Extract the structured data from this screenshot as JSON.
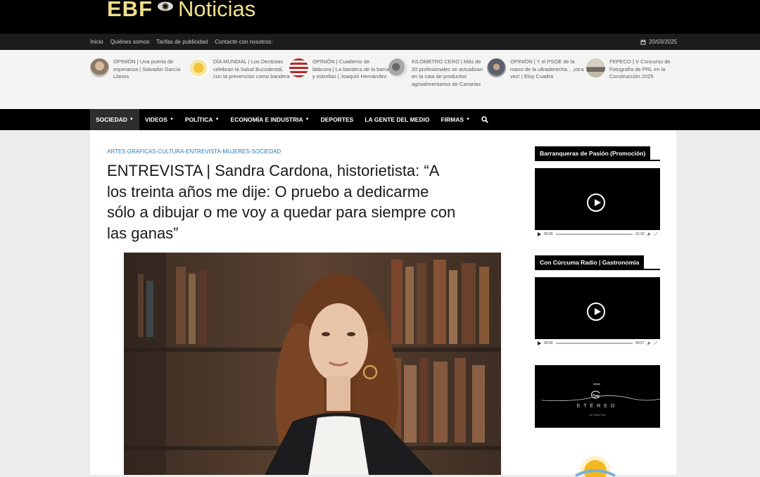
{
  "logo": {
    "ebf": "EBF",
    "noticias": "Noticias"
  },
  "topbar": {
    "links": [
      "Inicio",
      "Quiénes somos",
      "Tarifas de publicidad",
      "Contacte con nosotros:"
    ],
    "date": "20/03/2025"
  },
  "ticker": [
    {
      "text": "OPINIÓN | Una puerta de esperanza | Salvador García Llanos"
    },
    {
      "text": "DÍA MUNDIAL | Los Dentistas celebran la Salud Bucodental, con la prevención como bandera"
    },
    {
      "text": "OPINIÓN | Cuaderno de bitácora | La bandera de la barra y estrellas | Joaquín Hernández"
    },
    {
      "text": "KILÓMETRO CERO | Más de 20 profesionales se actualizan en la cata de productos agroalimentarios de Canarias"
    },
    {
      "text": "OPINIÓN | Y el PSOE de la mano de la ultraderecha... ¡otra vez! | Eloy Cuadra"
    },
    {
      "text": "FEPECO | V Concurso de Fotografía de PRL en la Construcción 2025"
    }
  ],
  "nav": [
    "SOCIEDAD",
    "VIDEOS",
    "POLÍTICA",
    "ECONOMÍA E INDUSTRIA",
    "DEPORTES",
    "LA GENTE DEL MEDIO",
    "FIRMAS"
  ],
  "article": {
    "categories": "ARTES GRÁFICAS-CULTURA-ENTREVISTA-MUJERES-SOCIEDAD",
    "title": "ENTREVISTA | Sandra Cardona, historietista: “A los treinta años me dije: O pruebo a dedicarme sólo a dibujar o me voy a quedar para siempre con las ganas”"
  },
  "sidebar": {
    "widget1_title": "Barranqueras de Pasión (Promoción)",
    "video1": {
      "current": "00:00",
      "duration": "01:20"
    },
    "widget2_title": "Con Cúrcuma Radio | Gastronomía",
    "video2": {
      "current": "00:00",
      "duration": "00:57"
    },
    "ad_brand": "ETÉREO",
    "ad_by": "by Dalia Pud"
  },
  "colors": {
    "logo": "#f0e08a",
    "category_link": "#2a7ab0"
  }
}
